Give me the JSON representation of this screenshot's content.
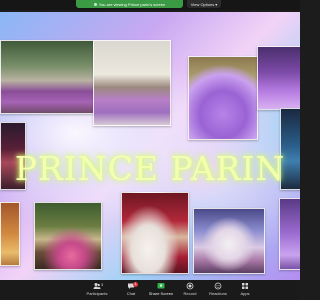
{
  "share_bar": {
    "notice": "You are viewing Prince parin's screen",
    "view_options": "View Options",
    "notice_color": "#3a9b44"
  },
  "slide": {
    "title": "PRINCE PARIN",
    "title_color": "#f4ffb0"
  },
  "toolbar": {
    "participants": {
      "label": "Participants",
      "count": "3",
      "icon": "participants-icon"
    },
    "chat": {
      "label": "Chat",
      "badge": "1",
      "icon": "chat-icon"
    },
    "share_screen": {
      "label": "Share Screen",
      "icon": "share-screen-icon",
      "color": "#2fb24c"
    },
    "record": {
      "label": "Record",
      "icon": "record-icon"
    },
    "reactions": {
      "label": "Reactions",
      "icon": "reactions-icon"
    },
    "apps": {
      "label": "Apps",
      "icon": "apps-icon"
    }
  }
}
